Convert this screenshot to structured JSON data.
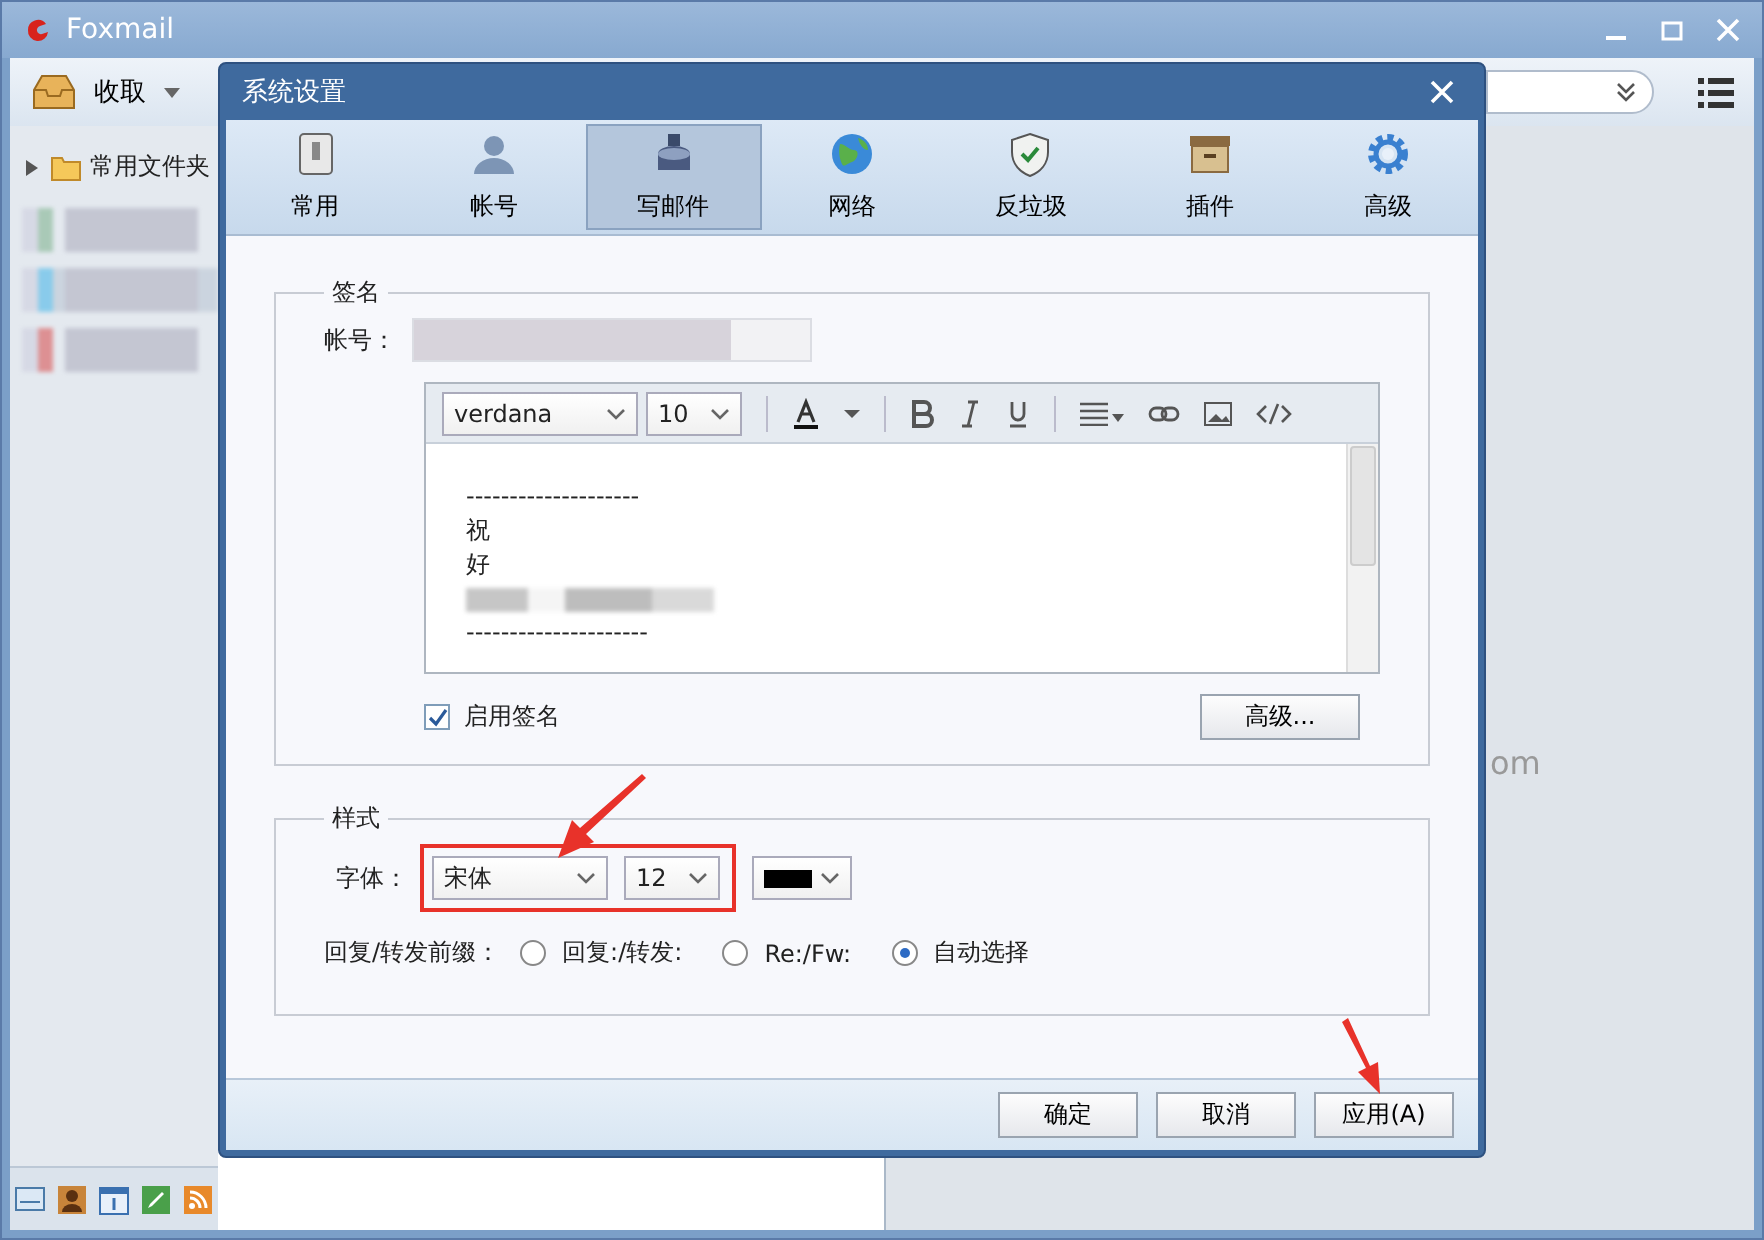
{
  "app": {
    "title": "Foxmail",
    "toolbar": {
      "receive": "收取"
    },
    "folders": [
      {
        "label": "常用文件夹",
        "expanded": false
      }
    ],
    "background_text": "om"
  },
  "dialog": {
    "title": "系统设置",
    "tabs": [
      {
        "label": "常用",
        "kind": "phone",
        "selected": false
      },
      {
        "label": "帐号",
        "kind": "person",
        "selected": false
      },
      {
        "label": "写邮件",
        "kind": "ink",
        "selected": true
      },
      {
        "label": "网络",
        "kind": "globe",
        "selected": false
      },
      {
        "label": "反垃圾",
        "kind": "shield",
        "selected": false
      },
      {
        "label": "插件",
        "kind": "box",
        "selected": false
      },
      {
        "label": "高级",
        "kind": "gear",
        "selected": false
      }
    ],
    "signature": {
      "legend": "签名",
      "account_label": "帐号：",
      "editor": {
        "font": "verdana",
        "size": "10",
        "lines": [
          {
            "kind": "text",
            "text": "--------------------"
          },
          {
            "kind": "text",
            "text": "祝"
          },
          {
            "kind": "text",
            "text": "好"
          },
          {
            "kind": "blurred"
          },
          {
            "kind": "text",
            "text": "---------------------"
          }
        ]
      },
      "enable": {
        "label": "启用签名",
        "checked": true
      },
      "advanced_button": "高级..."
    },
    "style": {
      "legend": "样式",
      "font_label": "字体：",
      "font": "宋体",
      "size": "12",
      "color": "#000000",
      "prefix_label": "回复/转发前缀：",
      "prefix_options": [
        {
          "label": "回复:/转发:",
          "selected": false
        },
        {
          "label": "Re:/Fw:",
          "selected": false
        },
        {
          "label": "自动选择",
          "selected": true
        }
      ]
    },
    "buttons": [
      "确定",
      "取消",
      "应用(A)"
    ]
  }
}
